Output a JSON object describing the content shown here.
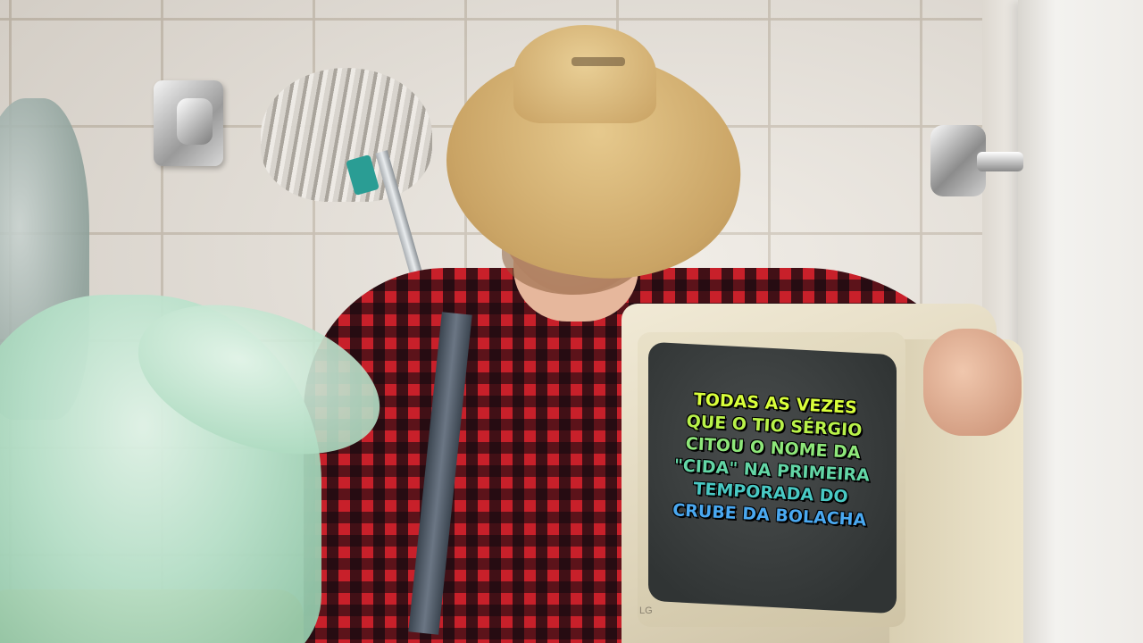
{
  "caption": {
    "lines": [
      "TODAS AS VEZES",
      "QUE O TIO SÉRGIO",
      "CITOU O NOME DA",
      "\"CIDA\" NA PRIMEIRA",
      "TEMPORADA DO",
      "CRUBE DA BOLACHA"
    ],
    "gradient_colors": [
      "#d9ff3b",
      "#b9f24a",
      "#8ee77a",
      "#63d6a6",
      "#49c9c4",
      "#4aa8f0"
    ]
  },
  "monitor": {
    "brand": "LG"
  },
  "icons": [
    "towel-hook-icon",
    "door-handle-icon",
    "mop-icon",
    "trash-bag-icon",
    "crt-monitor-icon",
    "cowboy-hat-icon"
  ]
}
